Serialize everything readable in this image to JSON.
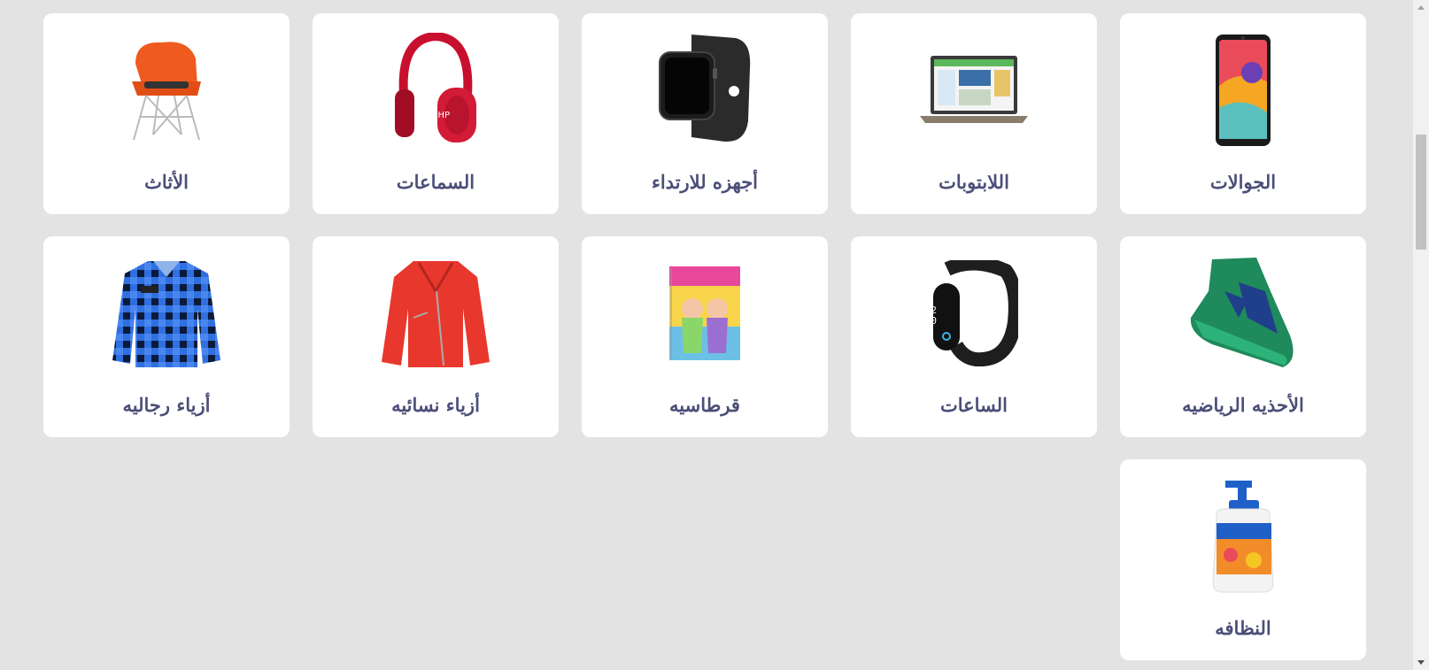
{
  "categories": [
    {
      "label": "الجوالات",
      "icon": "smartphone-icon"
    },
    {
      "label": "اللابتوبات",
      "icon": "laptop-icon"
    },
    {
      "label": "أجهزه للارتداء",
      "icon": "smartwatch-icon"
    },
    {
      "label": "السماعات",
      "icon": "headphones-icon"
    },
    {
      "label": "الأثاث",
      "icon": "chair-icon"
    },
    {
      "label": "الأحذيه الرياضيه",
      "icon": "sneaker-icon"
    },
    {
      "label": "الساعات",
      "icon": "fitness-band-icon"
    },
    {
      "label": "قرطاسيه",
      "icon": "notebook-icon"
    },
    {
      "label": "أزياء نسائيه",
      "icon": "jacket-icon"
    },
    {
      "label": "أزياء رجاليه",
      "icon": "shirt-icon"
    },
    {
      "label": "النظافه",
      "icon": "soap-bottle-icon"
    }
  ],
  "colors": {
    "background": "#e3e3e3",
    "card": "#ffffff",
    "label": "#4b4f78"
  }
}
